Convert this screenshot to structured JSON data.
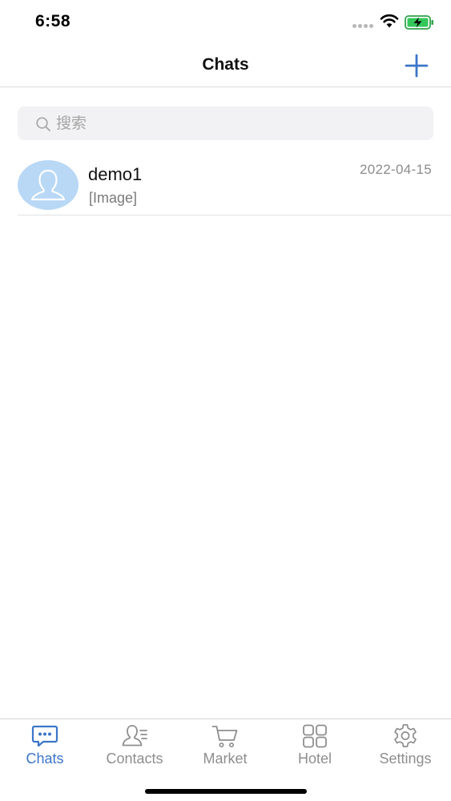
{
  "status_bar": {
    "time": "6:58",
    "icons": [
      "signal-dots-icon",
      "wifi-icon",
      "battery-charging-icon"
    ]
  },
  "nav": {
    "title": "Chats",
    "add_icon": "plus-icon"
  },
  "search": {
    "placeholder": "搜索",
    "value": ""
  },
  "chats": [
    {
      "name": "demo1",
      "preview": "[Image]",
      "date": "2022-04-15",
      "avatar": "person-silhouette-icon"
    }
  ],
  "tabs": [
    {
      "label": "Chats",
      "icon": "chat-bubble-icon",
      "active": true
    },
    {
      "label": "Contacts",
      "icon": "contacts-icon",
      "active": false
    },
    {
      "label": "Market",
      "icon": "cart-icon",
      "active": false
    },
    {
      "label": "Hotel",
      "icon": "grid-icon",
      "active": false
    },
    {
      "label": "Settings",
      "icon": "gear-icon",
      "active": false
    }
  ],
  "colors": {
    "accent": "#3b76c9",
    "avatar_bg": "#b9d8f6",
    "inactive_tab": "#8e8e8e",
    "search_bg": "#f2f2f4"
  }
}
